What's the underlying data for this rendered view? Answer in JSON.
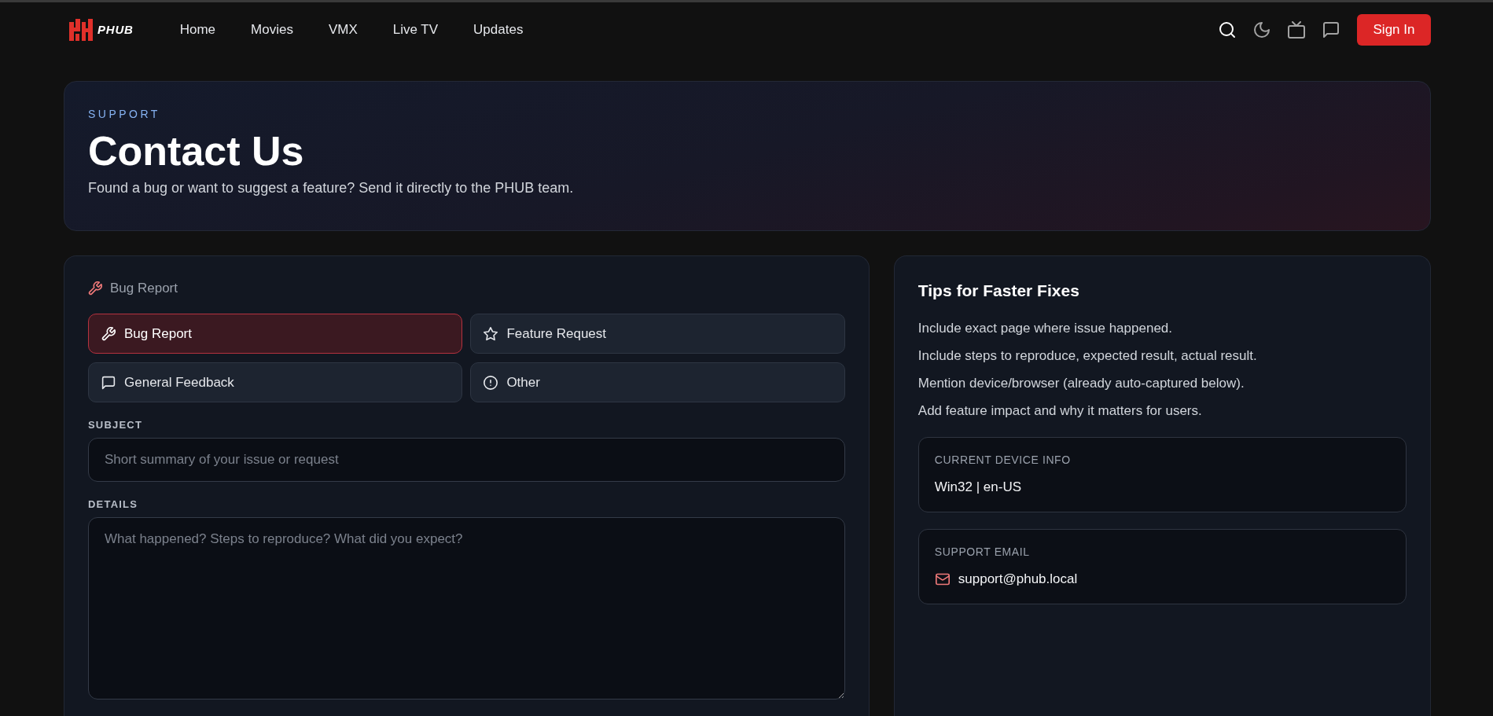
{
  "header": {
    "logo_text": "PHUB",
    "nav_links": [
      "Home",
      "Movies",
      "VMX",
      "Live TV",
      "Updates"
    ],
    "sign_in": "Sign In"
  },
  "hero": {
    "eyebrow": "SUPPORT",
    "title": "Contact Us",
    "subtitle": "Found a bug or want to suggest a feature? Send it directly to the PHUB team."
  },
  "form": {
    "heading": "Bug Report",
    "types": [
      {
        "label": "Bug Report",
        "selected": true
      },
      {
        "label": "Feature Request",
        "selected": false
      },
      {
        "label": "General Feedback",
        "selected": false
      },
      {
        "label": "Other",
        "selected": false
      }
    ],
    "subject": {
      "label": "SUBJECT",
      "placeholder": "Short summary of your issue or request"
    },
    "details": {
      "label": "DETAILS",
      "placeholder": "What happened? Steps to reproduce? What did you expect?"
    }
  },
  "tips": {
    "title": "Tips for Faster Fixes",
    "items": [
      "Include exact page where issue happened.",
      "Include steps to reproduce, expected result, actual result.",
      "Mention device/browser (already auto-captured below).",
      "Add feature impact and why it matters for users."
    ],
    "device_info": {
      "label": "CURRENT DEVICE INFO",
      "value": "Win32 | en-US"
    },
    "support_email": {
      "label": "SUPPORT EMAIL",
      "value": "support@phub.local"
    }
  }
}
